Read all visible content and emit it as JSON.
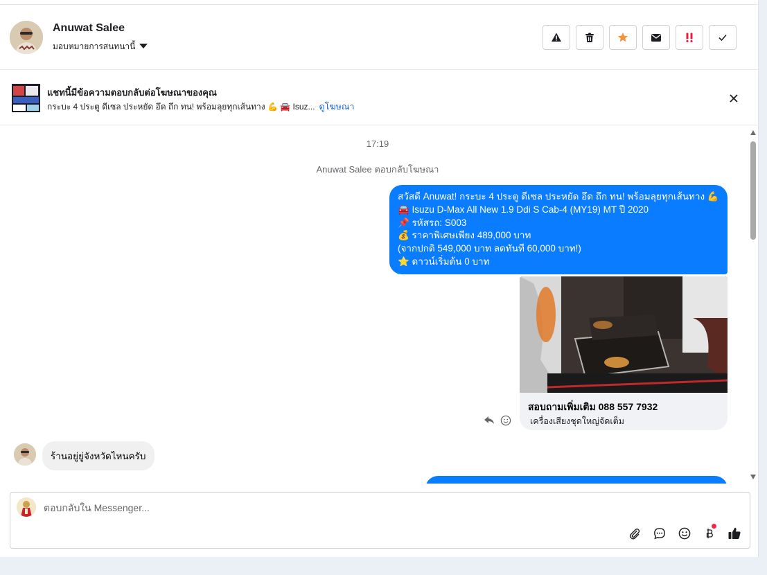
{
  "header": {
    "contact_name": "Anuwat Salee",
    "assign_label": "มอบหมายการสนทนานี้",
    "actions": [
      "warning-icon",
      "trash-icon",
      "star-icon",
      "envelope-icon",
      "important-icon",
      "check-icon"
    ]
  },
  "ad": {
    "title": "แชทนี้มีข้อความตอบกลับต่อโฆษณาของคุณ",
    "subtitle": "กระบะ 4 ประตู ดีเซล ประหยัด อึด ถึก ทน! พร้อมลุยทุกเส้นทาง 💪 🚘 Isuz...",
    "link": "ดูโฆษณา"
  },
  "thread": {
    "timestamp": "17:19",
    "system_note": "Anuwat Salee ตอบกลับโฆษณา",
    "outgoing_lines": [
      "สวัสดี Anuwat! กระบะ 4 ประตู ดีเซล ประหยัด อึด ถึก ทน! พร้อมลุยทุกเส้นทาง 💪",
      "🚘 Isuzu D-Max All New 1.9 Ddi S Cab-4 (MY19) MT ปี 2020",
      "📌 รหัสรถ: S003",
      "💰 ราคาพิเศษเพียง 489,000 บาท",
      "(จากปกติ 549,000 บาท ลดทันที 60,000 บาท!)",
      "⭐ ดาวน์เริ่มต้น 0 บาท"
    ],
    "card": {
      "title": "สอบถามเพิ่มเติม 088 557 7932",
      "subtitle": "เครื่องเสียงชุดใหญ่จัดเต็ม"
    },
    "incoming": "ร้านอยู่ยู่จังหวัดไหนครับ"
  },
  "composer": {
    "placeholder": "ตอบกลับใน Messenger..."
  },
  "colors": {
    "bubble_out": "#0a7cff",
    "bubble_in": "#f0f0f0",
    "star": "#f7923a",
    "important": "#e41e3f",
    "link": "#1a66d3"
  }
}
